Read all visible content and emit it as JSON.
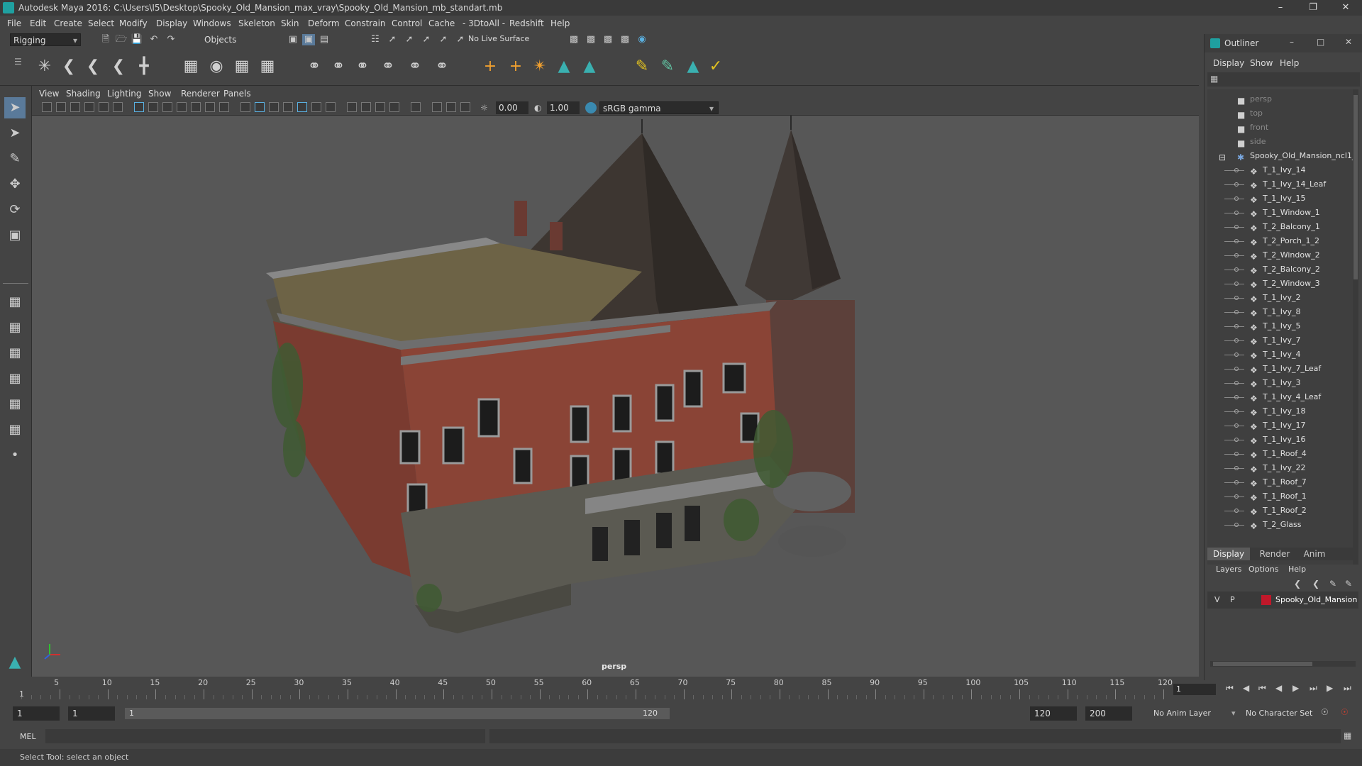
{
  "window": {
    "title": "Autodesk Maya 2016: C:\\Users\\I5\\Desktop\\Spooky_Old_Mansion_max_vray\\Spooky_Old_Mansion_mb_standart.mb",
    "controls": [
      "minimize-icon",
      "restore-icon",
      "close-icon"
    ]
  },
  "menubar": [
    "File",
    "Edit",
    "Create",
    "Select",
    "Modify",
    "Display",
    "Windows",
    "Skeleton",
    "Skin",
    "Deform",
    "Constrain",
    "Control",
    "Cache",
    "- 3DtoAll -",
    "Redshift",
    "Help"
  ],
  "statusline": {
    "menuset": "Rigging",
    "selection_mode": "Objects",
    "live_surface": "No Live Surface"
  },
  "panel": {
    "menus": [
      "View",
      "Shading",
      "Lighting",
      "Show",
      "Renderer",
      "Panels"
    ],
    "exposure": "0.00",
    "gamma": "1.00",
    "color_space": "sRGB gamma",
    "camera_label": "persp"
  },
  "outliner": {
    "title": "Outliner",
    "menus": [
      "Display",
      "Show",
      "Help"
    ],
    "cameras": [
      "persp",
      "top",
      "front",
      "side"
    ],
    "root": "Spooky_Old_Mansion_ncl1_",
    "children": [
      "T_1_Ivy_14",
      "T_1_Ivy_14_Leaf",
      "T_1_Ivy_15",
      "T_1_Window_1",
      "T_2_Balcony_1",
      "T_2_Porch_1_2",
      "T_2_Window_2",
      "T_2_Balcony_2",
      "T_2_Window_3",
      "T_1_Ivy_2",
      "T_1_Ivy_8",
      "T_1_Ivy_5",
      "T_1_Ivy_7",
      "T_1_Ivy_4",
      "T_1_Ivy_7_Leaf",
      "T_1_Ivy_3",
      "T_1_Ivy_4_Leaf",
      "T_1_Ivy_18",
      "T_1_Ivy_17",
      "T_1_Ivy_16",
      "T_1_Roof_4",
      "T_1_Ivy_22",
      "T_1_Roof_7",
      "T_1_Roof_1",
      "T_1_Roof_2",
      "T_2_Glass"
    ]
  },
  "layer_editor": {
    "tabs": [
      "Display",
      "Render",
      "Anim"
    ],
    "menus": [
      "Layers",
      "Options",
      "Help"
    ],
    "layer": {
      "v": "V",
      "p": "P",
      "name": "Spooky_Old_Mansion",
      "color": "#c0182a"
    }
  },
  "timeline": {
    "ticks": [
      "5",
      "10",
      "15",
      "20",
      "25",
      "30",
      "35",
      "40",
      "45",
      "50",
      "55",
      "60",
      "65",
      "70",
      "75",
      "80",
      "85",
      "90",
      "95",
      "100",
      "105",
      "110",
      "115",
      "120"
    ],
    "start_marker": "1",
    "current_frame": "1"
  },
  "range": {
    "start": "1",
    "inner_start": "1",
    "slider_start": "1",
    "slider_end": "120",
    "end": "120",
    "anim_end": "200",
    "anim_layer": "No Anim Layer",
    "character_set": "No Character Set"
  },
  "command": {
    "lang": "MEL"
  },
  "helpline": "Select Tool: select an object",
  "colors": {
    "ui_bg": "#444444",
    "viewport_bg": "#575757",
    "accent": "#5ab0e0"
  }
}
